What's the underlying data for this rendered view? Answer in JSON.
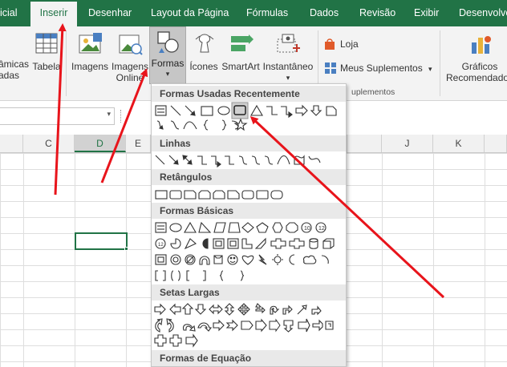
{
  "ribbon_tabs": {
    "t0": "icial",
    "t1": "Inserir",
    "t2": "Desenhar",
    "t3": "Layout da Página",
    "t4": "Fórmulas",
    "t5": "Dados",
    "t6": "Revisão",
    "t7": "Exibir",
    "t8": "Desenvolve"
  },
  "ribbon_buttons": {
    "pivot_line1": "âmicas",
    "pivot_line2": "adas",
    "tabela": "Tabela",
    "imagens": "Imagens",
    "imagens_online_line1": "Imagens",
    "imagens_online_line2": "Online",
    "formas": "Formas",
    "formas_caret": "▾",
    "icones": "Ícones",
    "smartart": "SmartArt",
    "instantaneo": "Instantâneo",
    "instantaneo_caret": "▾",
    "loja": "Loja",
    "meus_suplementos": "Meus Suplementos",
    "meus_suplementos_caret": "▾",
    "graficos_line1": "Gráficos",
    "graficos_line2": "Recomendados",
    "group_suplementos": "uplementos"
  },
  "namebox_arrow": "▾",
  "columns": {
    "b": "",
    "c": "C",
    "d": "D",
    "e": "E",
    "j": "J",
    "k": "K"
  },
  "gallery": {
    "recent": "Formas Usadas Recentemente",
    "linhas": "Linhas",
    "retangulos": "Retângulos",
    "basicas": "Formas Básicas",
    "setas": "Setas Largas",
    "equacao": "Formas de Equação"
  },
  "colors": {
    "excel_green": "#217346",
    "annotation_red": "#e8141b"
  }
}
